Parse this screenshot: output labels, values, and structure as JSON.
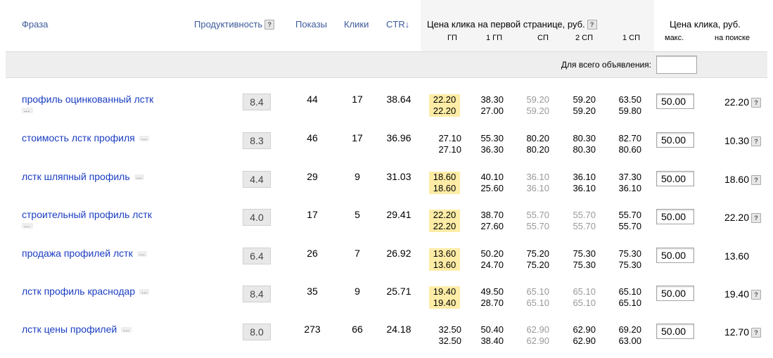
{
  "header": {
    "phrase": "Фраза",
    "productivity": "Продуктивность",
    "shows": "Показы",
    "clicks": "Клики",
    "ctr": "CTR↓",
    "price_first_page": "Цена клика на первой странице, руб.",
    "price_click": "Цена клика, руб.",
    "sub_gp": "ГП",
    "sub_1gp": "1 ГП",
    "sub_sp": "СП",
    "sub_2sp": "2 СП",
    "sub_1sp": "1 СП",
    "sub_max": "макс.",
    "sub_search": "на поиске",
    "qmark": "?"
  },
  "band": {
    "label": "Для всего объявления:",
    "input_value": ""
  },
  "dots": "...",
  "rows": [
    {
      "phrase": "профиль оцинкованный лстк",
      "dots_below": true,
      "prod": "8.4",
      "shows": "44",
      "clicks": "17",
      "ctr": "38.64",
      "gp": [
        "22.20",
        "22.20"
      ],
      "gp_hl": true,
      "gp1": [
        "38.30",
        "27.00"
      ],
      "sp": [
        "59.20",
        "59.20"
      ],
      "sp_gray": true,
      "sp2": [
        "59.20",
        "59.20"
      ],
      "sp2_gray": false,
      "sp1": [
        "63.50",
        "59.80"
      ],
      "bid": "50.00",
      "search": "22.20",
      "search_q": true
    },
    {
      "phrase": "стоимость лстк профиля",
      "dots_below": false,
      "prod": "8.3",
      "shows": "46",
      "clicks": "17",
      "ctr": "36.96",
      "gp": [
        "27.10",
        "27.10"
      ],
      "gp_hl": false,
      "gp1": [
        "55.30",
        "36.30"
      ],
      "sp": [
        "80.20",
        "80.20"
      ],
      "sp_gray": false,
      "sp2": [
        "80.30",
        "80.30"
      ],
      "sp2_gray": false,
      "sp1": [
        "82.70",
        "80.60"
      ],
      "bid": "50.00",
      "search": "10.30",
      "search_q": true
    },
    {
      "phrase": "лстк шляпный профиль",
      "dots_below": false,
      "prod": "4.4",
      "shows": "29",
      "clicks": "9",
      "ctr": "31.03",
      "gp": [
        "18.60",
        "18.60"
      ],
      "gp_hl": true,
      "gp1": [
        "40.10",
        "25.60"
      ],
      "sp": [
        "36.10",
        "36.10"
      ],
      "sp_gray": true,
      "sp2": [
        "36.10",
        "36.10"
      ],
      "sp2_gray": false,
      "sp1": [
        "37.30",
        "36.10"
      ],
      "bid": "50.00",
      "search": "18.60",
      "search_q": true
    },
    {
      "phrase": "строительный профиль лстк",
      "dots_below": true,
      "prod": "4.0",
      "shows": "17",
      "clicks": "5",
      "ctr": "29.41",
      "gp": [
        "22.20",
        "22.20"
      ],
      "gp_hl": true,
      "gp1": [
        "38.70",
        "27.60"
      ],
      "sp": [
        "55.70",
        "55.70"
      ],
      "sp_gray": true,
      "sp2": [
        "55.70",
        "55.70"
      ],
      "sp2_gray": true,
      "sp1": [
        "55.70",
        "55.70"
      ],
      "bid": "50.00",
      "search": "22.20",
      "search_q": true
    },
    {
      "phrase": "продажа профилей лстк",
      "dots_below": false,
      "prod": "6.4",
      "shows": "26",
      "clicks": "7",
      "ctr": "26.92",
      "gp": [
        "13.60",
        "13.60"
      ],
      "gp_hl": true,
      "gp1": [
        "50.20",
        "24.70"
      ],
      "sp": [
        "75.20",
        "75.20"
      ],
      "sp_gray": false,
      "sp2": [
        "75.30",
        "75.30"
      ],
      "sp2_gray": false,
      "sp1": [
        "75.30",
        "75.30"
      ],
      "bid": "50.00",
      "search": "13.60",
      "search_q": false
    },
    {
      "phrase": "лстк профиль краснодар",
      "dots_below": false,
      "prod": "8.4",
      "shows": "35",
      "clicks": "9",
      "ctr": "25.71",
      "gp": [
        "19.40",
        "19.40"
      ],
      "gp_hl": true,
      "gp1": [
        "49.50",
        "28.70"
      ],
      "sp": [
        "65.10",
        "65.10"
      ],
      "sp_gray": true,
      "sp2": [
        "65.10",
        "65.10"
      ],
      "sp2_gray": true,
      "sp1": [
        "65.10",
        "65.10"
      ],
      "bid": "50.00",
      "search": "19.40",
      "search_q": true
    },
    {
      "phrase": "лстк цены профилей",
      "dots_below": false,
      "prod": "8.0",
      "shows": "273",
      "clicks": "66",
      "ctr": "24.18",
      "gp": [
        "32.50",
        "32.50"
      ],
      "gp_hl": false,
      "gp1": [
        "50.40",
        "38.40"
      ],
      "sp": [
        "62.90",
        "62.90"
      ],
      "sp_gray": true,
      "sp2": [
        "62.90",
        "62.90"
      ],
      "sp2_gray": false,
      "sp1": [
        "69.20",
        "63.00"
      ],
      "bid": "50.00",
      "search": "12.70",
      "search_q": true
    }
  ]
}
